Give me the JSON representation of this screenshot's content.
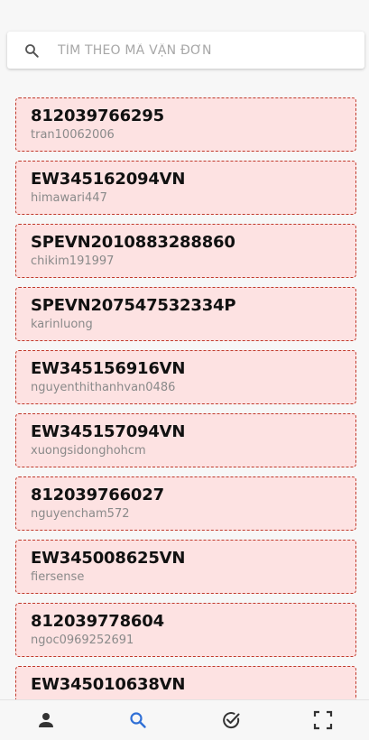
{
  "search": {
    "placeholder": "TÌM THEO MÃ VẬN ĐƠN",
    "value": ""
  },
  "shipments": [
    {
      "code": "812039766295",
      "user": "tran10062006"
    },
    {
      "code": "EW345162094VN",
      "user": "himawari447"
    },
    {
      "code": "SPEVN2010883288860",
      "user": "chikim191997"
    },
    {
      "code": "SPEVN207547532334P",
      "user": "karinluong"
    },
    {
      "code": "EW345156916VN",
      "user": "nguyenthithanhvan0486"
    },
    {
      "code": "EW345157094VN",
      "user": "xuongsidonghohcm"
    },
    {
      "code": "812039766027",
      "user": "nguyencham572"
    },
    {
      "code": "EW345008625VN",
      "user": "fiersense"
    },
    {
      "code": "812039778604",
      "user": "ngoc0969252691"
    },
    {
      "code": "EW345010638VN",
      "user": ""
    }
  ],
  "nav": {
    "items": [
      {
        "icon": "person-icon",
        "active": false
      },
      {
        "icon": "search-icon",
        "active": true
      },
      {
        "icon": "check-circle-icon",
        "active": false
      },
      {
        "icon": "scan-icon",
        "active": false
      }
    ],
    "active_color": "#2f6fd6",
    "inactive_color": "#333333"
  },
  "colors": {
    "card_background": "#fde2e2",
    "card_border": "#c0392b"
  }
}
